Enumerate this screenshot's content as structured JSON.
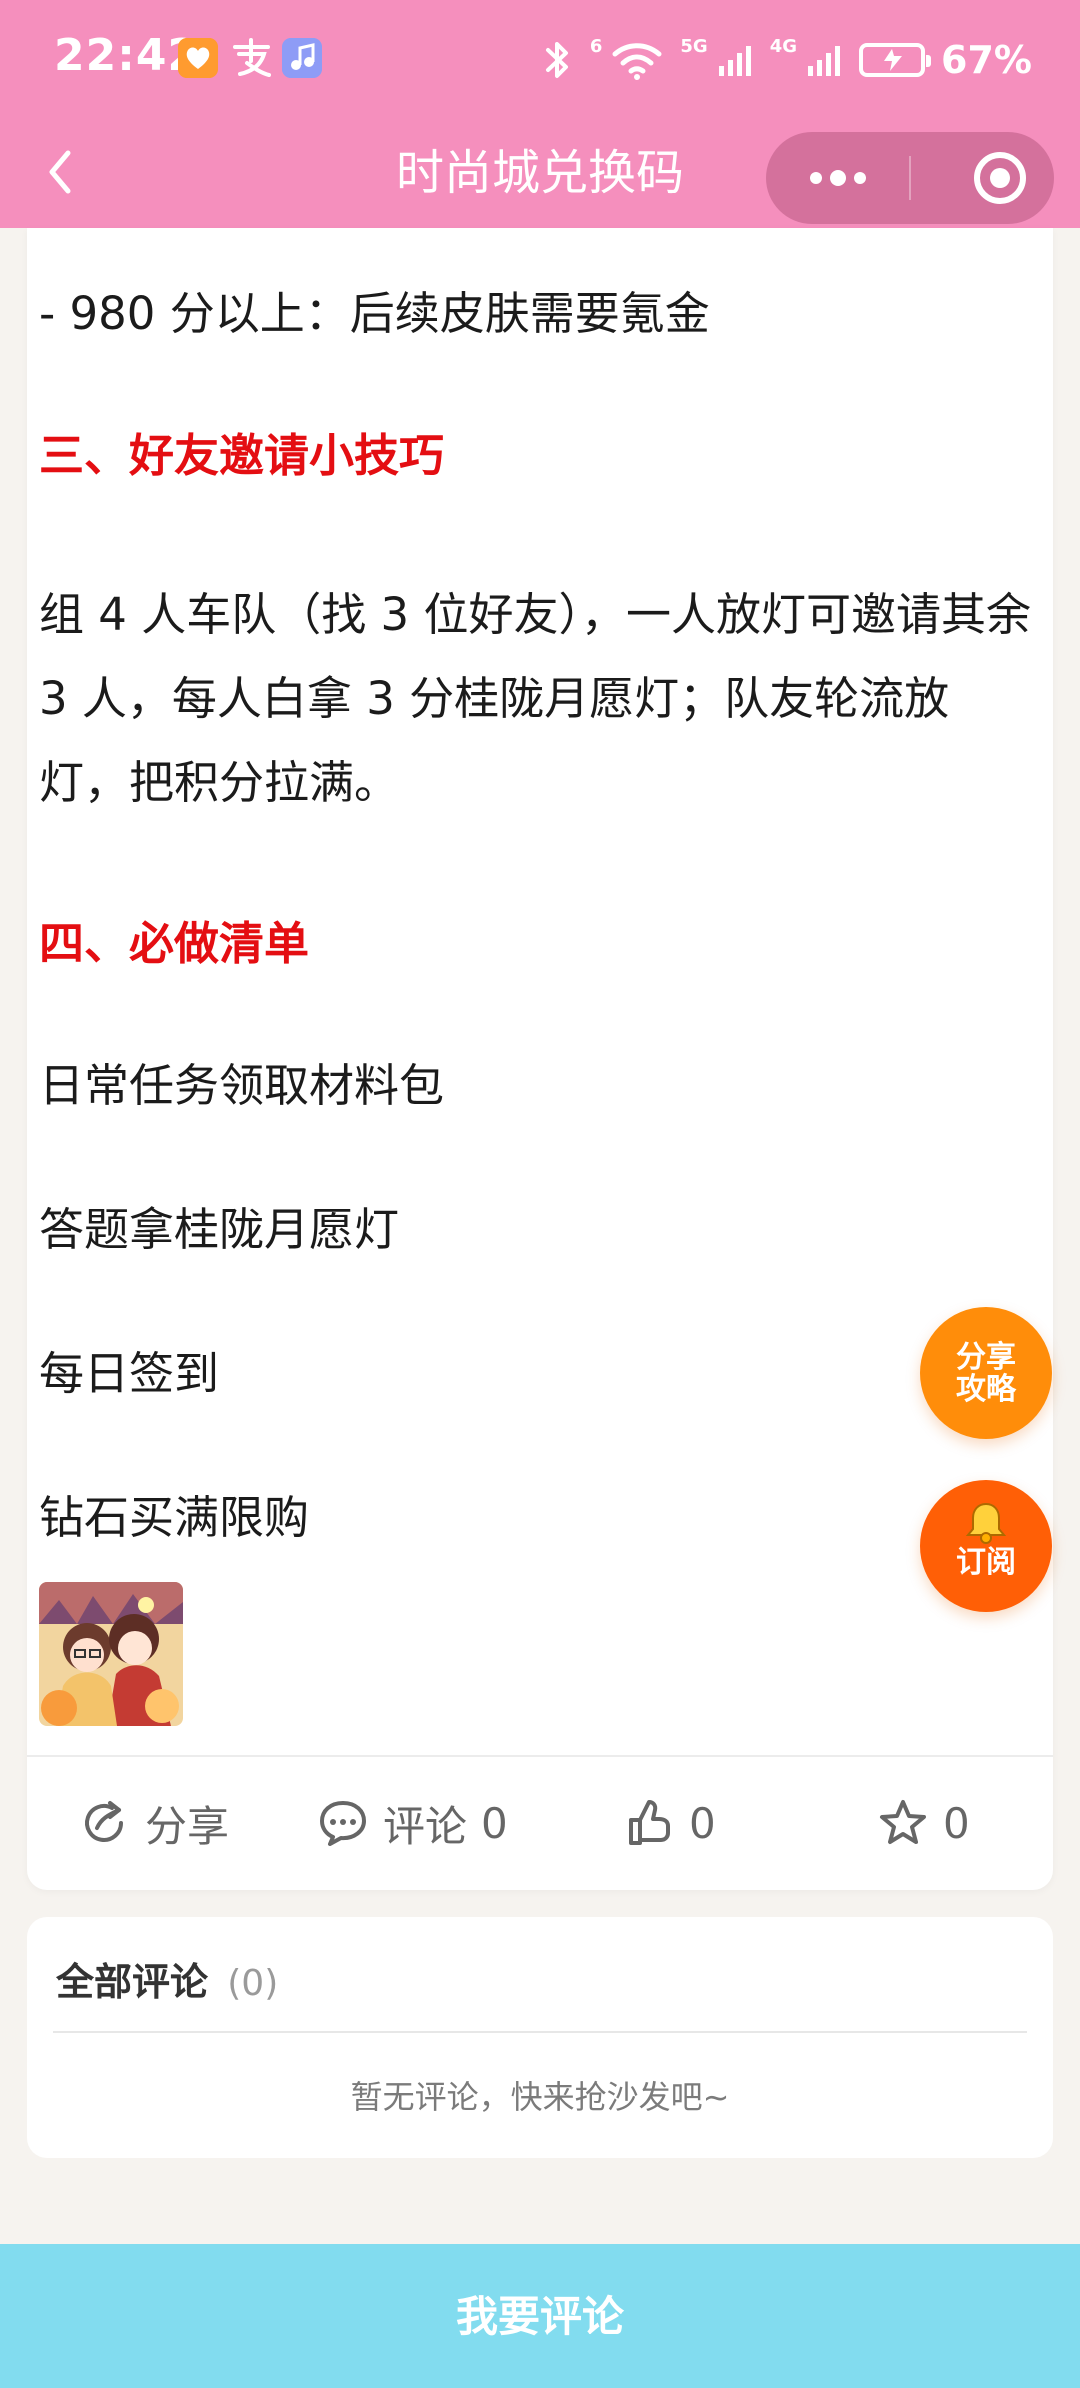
{
  "status_bar": {
    "time": "22:42",
    "signal_1_label": "6",
    "signal_2_label": "5G",
    "signal_3_label": "4G",
    "battery": "67%"
  },
  "nav": {
    "title": "时尚城兑换码"
  },
  "article": {
    "line_1": "- 980 分以上：后续皮肤需要氪金",
    "heading_3": "三、好友邀请小技巧",
    "paragraph_3": "组 4 人车队（找 3 位好友），一人放灯可邀请其余 3 人，每人白拿 3 分桂陇月愿灯；队友轮流放灯，把积分拉满。",
    "heading_4": "四、必做清单",
    "checklist": [
      "日常任务领取材料包",
      "答题拿桂陇月愿灯",
      "每日签到",
      "钻石买满限购"
    ]
  },
  "actions": {
    "share_label": "分享",
    "comment_label": "评论",
    "comment_count": "0",
    "like_count": "0",
    "favorite_count": "0"
  },
  "comments": {
    "title": "全部评论",
    "count": "(0)",
    "empty_text": "暂无评论，快来抢沙发吧~"
  },
  "floating": {
    "share_guide_label_1": "分享",
    "share_guide_label_2": "攻略",
    "subscribe_label": "订阅"
  },
  "bottom": {
    "comment_button_label": "我要评论"
  },
  "colors": {
    "header_pink": "#f58fbd",
    "heading_red": "#e40e12",
    "fab_orange": "#ff8d0a",
    "fab_red_orange": "#ff5f06",
    "bottom_blue": "#82dcef"
  },
  "icons": {
    "back": "chevron-left-icon",
    "more": "more-dots-icon",
    "close": "target-close-icon",
    "share": "share-arrow-icon",
    "comment": "chat-bubble-icon",
    "like": "thumbs-up-icon",
    "favorite": "star-icon",
    "subscribe": "bell-icon"
  }
}
